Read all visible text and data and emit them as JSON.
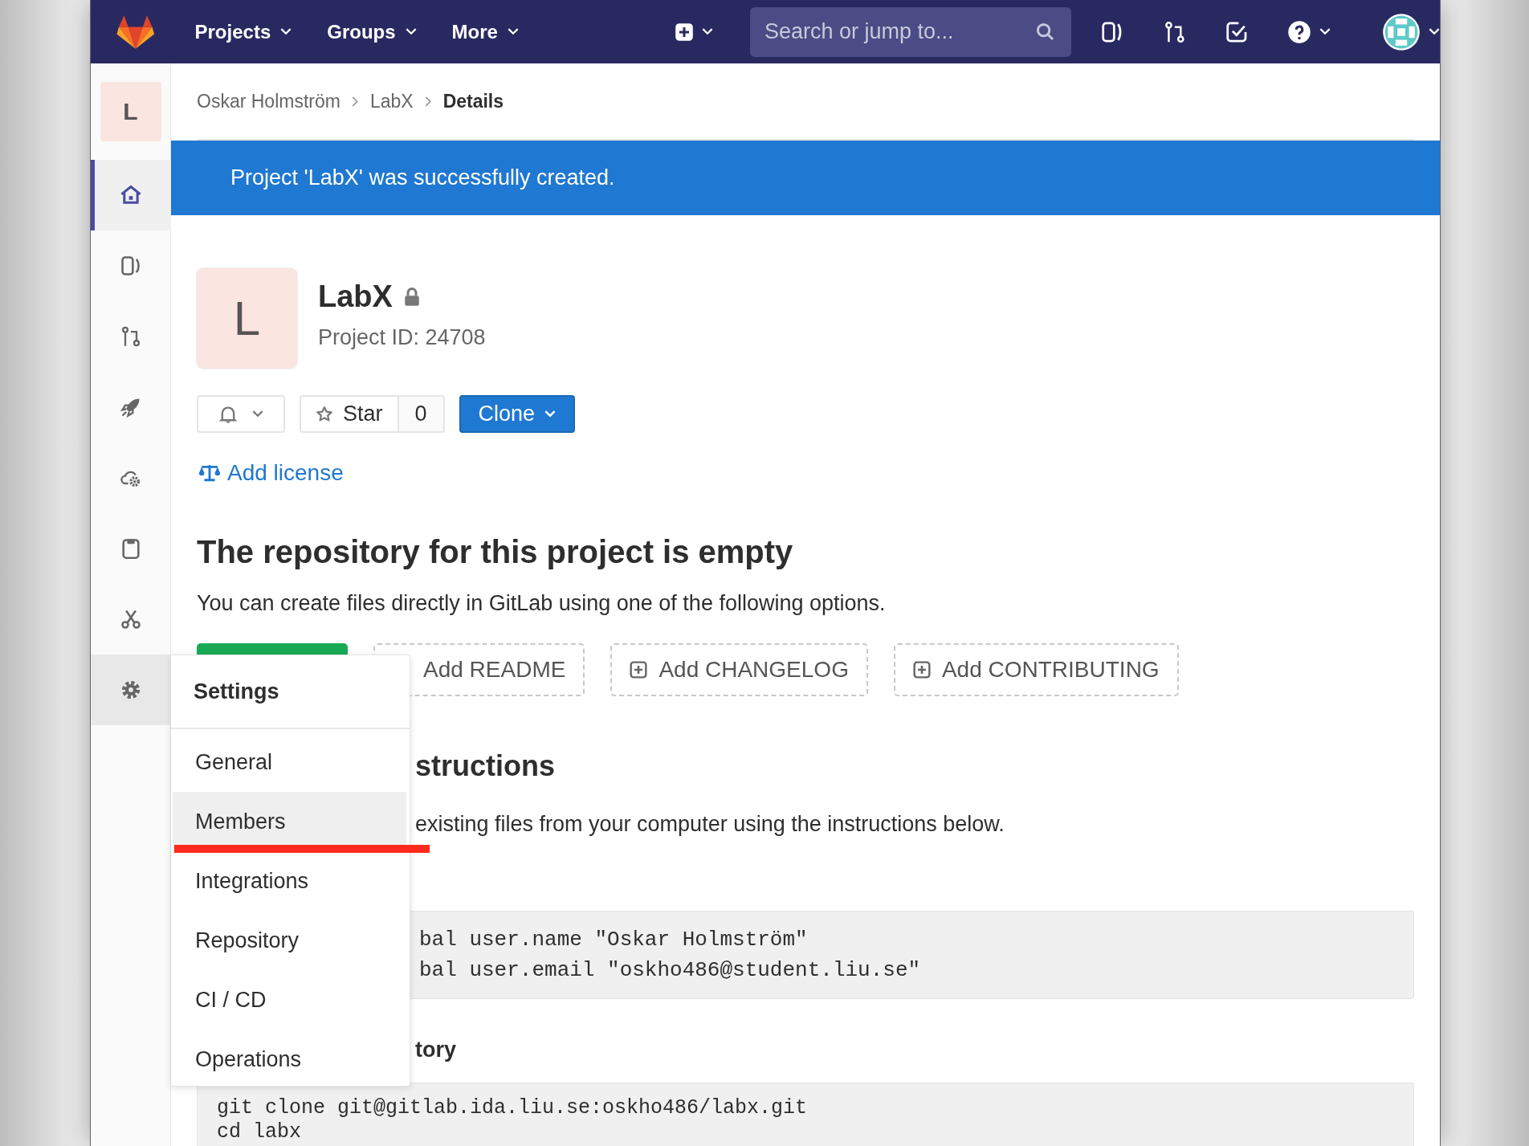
{
  "nav": {
    "menus": [
      {
        "label": "Projects"
      },
      {
        "label": "Groups"
      },
      {
        "label": "More"
      }
    ],
    "search": {
      "placeholder": "Search or jump to..."
    }
  },
  "sidebar": {
    "project_letter": "L",
    "items": [
      {
        "kind": "home",
        "selected": true,
        "expanded": false
      },
      {
        "kind": "issues",
        "selected": false,
        "expanded": false
      },
      {
        "kind": "merge",
        "selected": false,
        "expanded": false
      },
      {
        "kind": "rocket",
        "selected": false,
        "expanded": false
      },
      {
        "kind": "cloud",
        "selected": false,
        "expanded": false
      },
      {
        "kind": "package",
        "selected": false,
        "expanded": false
      },
      {
        "kind": "snippets",
        "selected": false,
        "expanded": false
      },
      {
        "kind": "settings",
        "selected": false,
        "expanded": true
      }
    ]
  },
  "breadcrumbs": [
    {
      "label": "Oskar Holmström",
      "current": false
    },
    {
      "label": "LabX",
      "current": false
    },
    {
      "label": "Details",
      "current": true
    }
  ],
  "flash": "Project 'LabX' was successfully created.",
  "project": {
    "letter": "L",
    "name": "LabX",
    "private": true,
    "id_text": "Project ID: 24708"
  },
  "actions": {
    "star_label": "Star",
    "star_count": "0",
    "clone_label": "Clone"
  },
  "add_license": "Add license",
  "empty": {
    "title": "The repository for this project is empty",
    "text": "You can create files directly in GitLab using one of the following options.",
    "file_buttons": [
      {
        "label": "Add README"
      },
      {
        "label": "Add CHANGELOG"
      },
      {
        "label": "Add CONTRIBUTING"
      }
    ]
  },
  "instructions": {
    "title_fragment": "structions",
    "text_fragment": "existing files from your computer using the instructions below.",
    "config_lines": [
      "bal user.name \"Oskar Holmström\"",
      "bal user.email \"oskho486@student.liu.se\""
    ],
    "subtitle_fragment": "tory",
    "clone_lines": [
      "git clone git@gitlab.ida.liu.se:oskho486/labx.git",
      "cd labx"
    ]
  },
  "settings_menu": {
    "title": "Settings",
    "items": [
      {
        "label": "General",
        "selected": false,
        "underlined": false
      },
      {
        "label": "Members",
        "selected": true,
        "underlined": true
      },
      {
        "label": "Integrations",
        "selected": false,
        "underlined": false
      },
      {
        "label": "Repository",
        "selected": false,
        "underlined": false
      },
      {
        "label": "CI / CD",
        "selected": false,
        "underlined": false
      },
      {
        "label": "Operations",
        "selected": false,
        "underlined": false
      }
    ]
  }
}
